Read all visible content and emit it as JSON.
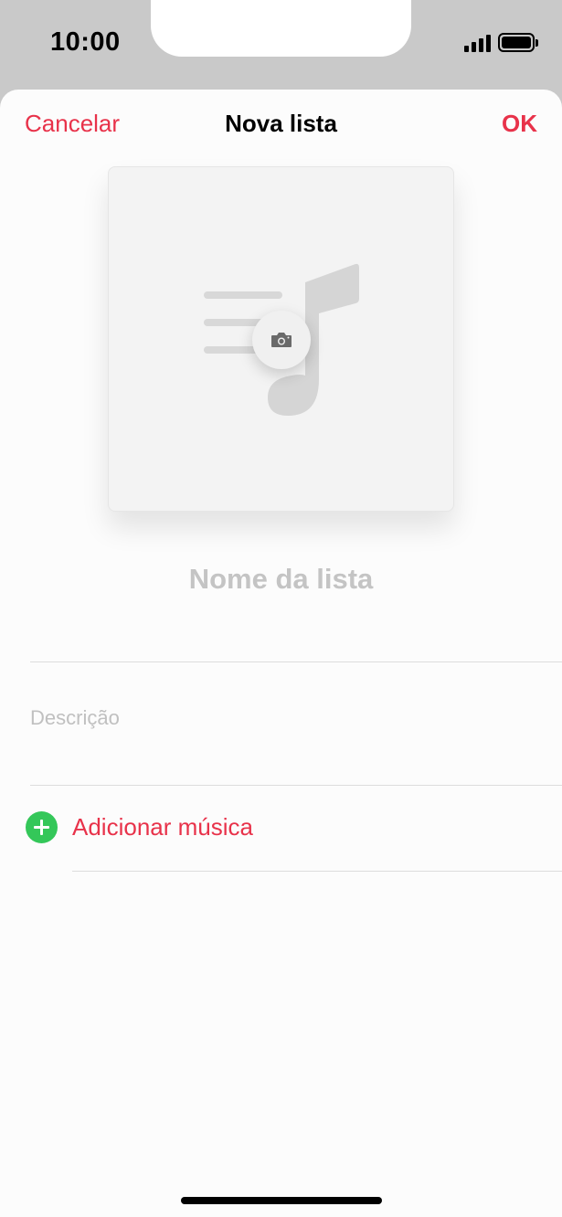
{
  "status_bar": {
    "time": "10:00",
    "icons": [
      "signal-icon",
      "battery-icon"
    ]
  },
  "nav": {
    "cancel_label": "Cancelar",
    "title": "Nova lista",
    "ok_label": "OK"
  },
  "artwork": {
    "placeholder_icon": "music-list-icon",
    "camera_icon": "camera-icon"
  },
  "form": {
    "name_placeholder": "Nome da lista",
    "description_placeholder": "Descrição",
    "add_music_label": "Adicionar música"
  },
  "colors": {
    "accent": "#e8324a",
    "add_green": "#34c759"
  }
}
